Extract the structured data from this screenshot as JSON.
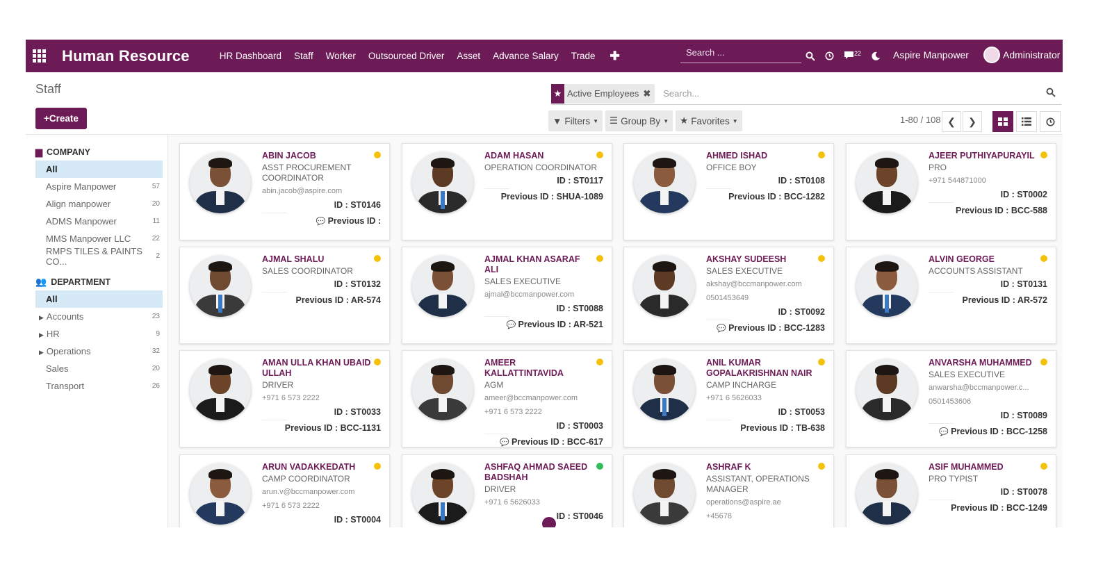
{
  "app": {
    "title": "Human Resource",
    "menu": [
      "HR Dashboard",
      "Staff",
      "Worker",
      "Outsourced Driver",
      "Asset",
      "Advance Salary",
      "Trade"
    ],
    "plus": "✚",
    "search_placeholder": "Search ...",
    "chat_count": "22",
    "company": "Aspire Manpower",
    "user": "Administrator"
  },
  "control_panel": {
    "page_title": "Staff",
    "create_label": "+Create",
    "facet_label": "Active Employees",
    "search_placeholder": "Search...",
    "filters_label": "Filters",
    "groupby_label": "Group By",
    "favorites_label": "Favorites",
    "pager": "1-80 / 108"
  },
  "side_panel": {
    "company": {
      "heading": "COMPANY",
      "items": [
        {
          "label": "All",
          "count": ""
        },
        {
          "label": "Aspire Manpower",
          "count": "57"
        },
        {
          "label": "Align manpower",
          "count": "20"
        },
        {
          "label": "ADMS Manpower",
          "count": "11"
        },
        {
          "label": "MMS Manpower LLC",
          "count": "22"
        },
        {
          "label": "RMPS TILES & PAINTS CO...",
          "count": "2"
        }
      ]
    },
    "department": {
      "heading": "DEPARTMENT",
      "items": [
        {
          "label": "All",
          "count": ""
        },
        {
          "label": "Accounts",
          "count": "23"
        },
        {
          "label": "HR",
          "count": "9"
        },
        {
          "label": "Operations",
          "count": "32"
        },
        {
          "label": "Sales",
          "count": "20"
        },
        {
          "label": "Transport",
          "count": "26"
        }
      ]
    }
  },
  "colors": {
    "brand": "#6d1b56",
    "status_away": "#f4c20d",
    "status_online": "#2ebd59",
    "active_filter": "#d5e9f6"
  },
  "employees": [
    {
      "name": "ABIN JACOB",
      "job": "ASST PROCUREMENT COORDINATOR",
      "email": "abin.jacob@aspire.com",
      "phone": "",
      "mobile": "",
      "id": "ID : ST0146",
      "prev": "Previous ID :",
      "chat": true,
      "status": "away"
    },
    {
      "name": "ADAM HASAN",
      "job": "OPERATION COORDINATOR",
      "email": "",
      "phone": "",
      "mobile": "",
      "id": "ID : ST0117",
      "prev": "Previous ID : SHUA-1089",
      "chat": false,
      "status": "away"
    },
    {
      "name": "AHMED ISHAD",
      "job": "OFFICE BOY",
      "email": "",
      "phone": "",
      "mobile": "",
      "id": "ID : ST0108",
      "prev": "Previous ID : BCC-1282",
      "chat": false,
      "status": "away"
    },
    {
      "name": "AJEER PUTHIYAPURAYIL",
      "job": "PRO",
      "email": "",
      "phone": "+971 544871000",
      "mobile": "",
      "id": "ID : ST0002",
      "prev": "Previous ID : BCC-588",
      "chat": false,
      "status": "away"
    },
    {
      "name": "AJMAL SHALU",
      "job": "SALES COORDINATOR",
      "email": "",
      "phone": "",
      "mobile": "",
      "id": "ID : ST0132",
      "prev": "Previous ID : AR-574",
      "chat": false,
      "status": "away"
    },
    {
      "name": "AJMAL KHAN ASARAF ALI",
      "job": "SALES EXECUTIVE",
      "email": "ajmal@bccmanpower.com",
      "phone": "",
      "mobile": "",
      "id": "ID : ST0088",
      "prev": "Previous ID : AR-521",
      "chat": true,
      "status": "away"
    },
    {
      "name": "AKSHAY SUDEESH",
      "job": "SALES EXECUTIVE",
      "email": "akshay@bccmanpower.com",
      "phone": "0501453649",
      "mobile": "",
      "id": "ID : ST0092",
      "prev": "Previous ID : BCC-1283",
      "chat": true,
      "status": "away"
    },
    {
      "name": "ALVIN GEORGE",
      "job": "ACCOUNTS ASSISTANT",
      "email": "",
      "phone": "",
      "mobile": "",
      "id": "ID : ST0131",
      "prev": "Previous ID : AR-572",
      "chat": false,
      "status": "away"
    },
    {
      "name": "AMAN ULLA KHAN UBAID ULLAH",
      "job": "DRIVER",
      "email": "",
      "phone": "+971 6 573 2222",
      "mobile": "",
      "id": "ID : ST0033",
      "prev": "Previous ID : BCC-1131",
      "chat": false,
      "status": "away"
    },
    {
      "name": "AMEER KALLATTINTAVIDA",
      "job": "AGM",
      "email": "ameer@bccmanpower.com",
      "phone": "+971 6 573 2222",
      "mobile": "",
      "id": "ID : ST0003",
      "prev": "Previous ID : BCC-617",
      "chat": true,
      "status": "away"
    },
    {
      "name": "ANIL KUMAR GOPALAKRISHNAN NAIR",
      "job": "CAMP INCHARGE",
      "email": "",
      "phone": "+971 6 5626033",
      "mobile": "",
      "id": "ID : ST0053",
      "prev": "Previous ID : TB-638",
      "chat": false,
      "status": "away"
    },
    {
      "name": "ANVARSHA MUHAMMED",
      "job": "SALES EXECUTIVE",
      "email": "anwarsha@bccmanpower.c...",
      "phone": "0501453606",
      "mobile": "",
      "id": "ID : ST0089",
      "prev": "Previous ID : BCC-1258",
      "chat": true,
      "status": "away"
    },
    {
      "name": "ARUN VADAKKEDATH",
      "job": "CAMP COORDINATOR",
      "email": "arun.v@bccmanpower.com",
      "phone": "+971 6 573 2222",
      "mobile": "",
      "id": "ID : ST0004",
      "prev": "",
      "chat": false,
      "status": "away"
    },
    {
      "name": "ASHFAQ AHMAD SAEED BADSHAH",
      "job": "DRIVER",
      "email": "",
      "phone": "+971 6 5626033",
      "mobile": "",
      "id": "ID : ST0046",
      "prev": "",
      "chat": false,
      "status": "online"
    },
    {
      "name": "ASHRAF K",
      "job": "ASSISTANT, OPERATIONS MANAGER",
      "email": "operations@aspire.ae",
      "phone": "+45678",
      "mobile": "",
      "id": "",
      "prev": "",
      "chat": false,
      "status": "away"
    },
    {
      "name": "ASIF MUHAMMED",
      "job": "PRO TYPIST",
      "email": "",
      "phone": "",
      "mobile": "",
      "id": "ID : ST0078",
      "prev": "Previous ID : BCC-1249",
      "chat": false,
      "status": "away"
    }
  ]
}
